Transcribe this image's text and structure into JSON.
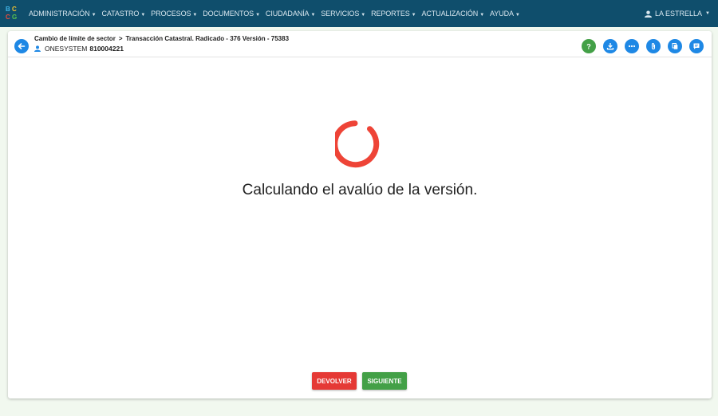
{
  "colors": {
    "topbar": "#0f4e6c",
    "accent": "#1e88e5",
    "spinner": "#ee4437",
    "danger": "#e53935",
    "success": "#43a047",
    "help": "#43a047"
  },
  "logo": {
    "text": "BCCG"
  },
  "nav": {
    "items": [
      {
        "label": "ADMINISTRACIÓN"
      },
      {
        "label": "CATASTRO"
      },
      {
        "label": "PROCESOS"
      },
      {
        "label": "DOCUMENTOS"
      },
      {
        "label": "CIUDADANÍA"
      },
      {
        "label": "SERVICIOS"
      },
      {
        "label": "REPORTES"
      },
      {
        "label": "ACTUALIZACIÓN"
      },
      {
        "label": "AYUDA"
      }
    ],
    "user": "LA ESTRELLA"
  },
  "header": {
    "breadcrumb_first": "Cambio de límite de sector",
    "breadcrumb_separator": ">",
    "breadcrumb_second": "Transacción Catastral. Radicado - 376 Versión - 75383",
    "owner_name": "ONESYSTEM",
    "owner_id": "810004221",
    "action_icons": [
      "help-icon",
      "download-icon",
      "more-icon",
      "attachment-icon",
      "copy-icon",
      "comment-icon"
    ]
  },
  "main": {
    "loading_text": "Calculando el avalúo de la versión."
  },
  "footer": {
    "devolver_label": "DEVOLVER",
    "siguiente_label": "SIGUIENTE"
  }
}
